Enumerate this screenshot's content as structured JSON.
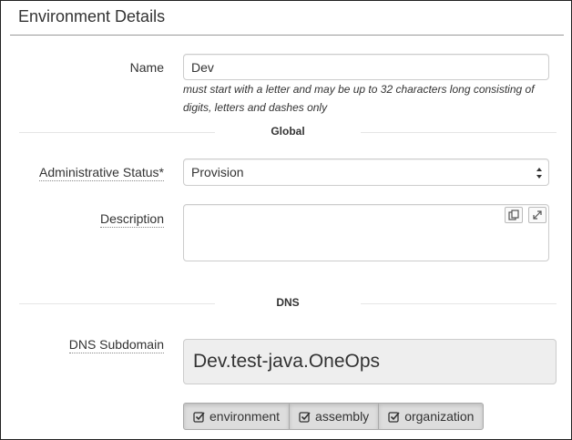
{
  "panel": {
    "title": "Environment Details"
  },
  "name": {
    "label": "Name",
    "value": "Dev",
    "help_line1": "must start with a letter and may be up to 32 characters long consisting of",
    "help_line2": "digits, letters and dashes only"
  },
  "sections": {
    "global": "Global",
    "dns": "DNS"
  },
  "admin_status": {
    "label": "Administrative Status*",
    "selected": "Provision"
  },
  "description": {
    "label": "Description",
    "value": ""
  },
  "dns_subdomain": {
    "label": "DNS Subdomain",
    "value": "Dev.test-java.OneOps",
    "toggles": [
      {
        "label": "environment",
        "checked": true
      },
      {
        "label": "assembly",
        "checked": true
      },
      {
        "label": "organization",
        "checked": true
      }
    ]
  },
  "icons": {
    "copy": "copy-icon",
    "expand": "expand-icon",
    "select": "select-arrows-icon",
    "check": "check-square-icon"
  }
}
